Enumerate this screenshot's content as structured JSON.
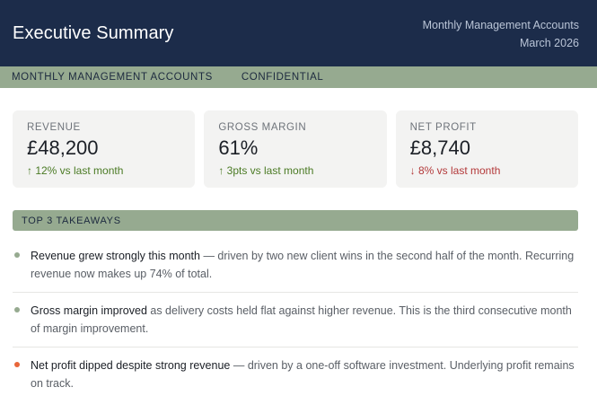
{
  "header": {
    "title": "Executive Summary",
    "meta_line1": "Monthly Management Accounts",
    "meta_line2": "March 2026"
  },
  "subbar": {
    "item1": "MONTHLY MANAGEMENT ACCOUNTS",
    "item2": "CONFIDENTIAL"
  },
  "kpis": [
    {
      "label": "REVENUE",
      "value": "£48,200",
      "delta": "↑ 12% vs last month",
      "trend": "up"
    },
    {
      "label": "GROSS MARGIN",
      "value": "61%",
      "delta": "↑ 3pts vs last month",
      "trend": "up"
    },
    {
      "label": "NET PROFIT",
      "value": "£8,740",
      "delta": "↓ 8% vs last month",
      "trend": "down"
    }
  ],
  "takeaways_section": {
    "title": "TOP 3 TAKEAWAYS",
    "items": [
      {
        "strong": "Revenue grew strongly this month",
        "rest": " — driven by two new client wins in the second half of the month. Recurring revenue now makes up 74% of total.",
        "bullet_color": "#96aa90"
      },
      {
        "strong": "Gross margin improved",
        "rest": " as delivery costs held flat against higher revenue. This is the third consecutive month of margin improvement.",
        "bullet_color": "#96aa90"
      },
      {
        "strong": "Net profit dipped despite strong revenue",
        "rest": " — driven by a one-off software investment. Underlying profit remains on track.",
        "bullet_color": "#e8663a"
      }
    ]
  },
  "colors": {
    "header_bg": "#1c2c4a",
    "accent_green": "#96aa90",
    "up": "#4a7a24",
    "down": "#b3393a",
    "warning_bullet": "#e8663a"
  }
}
